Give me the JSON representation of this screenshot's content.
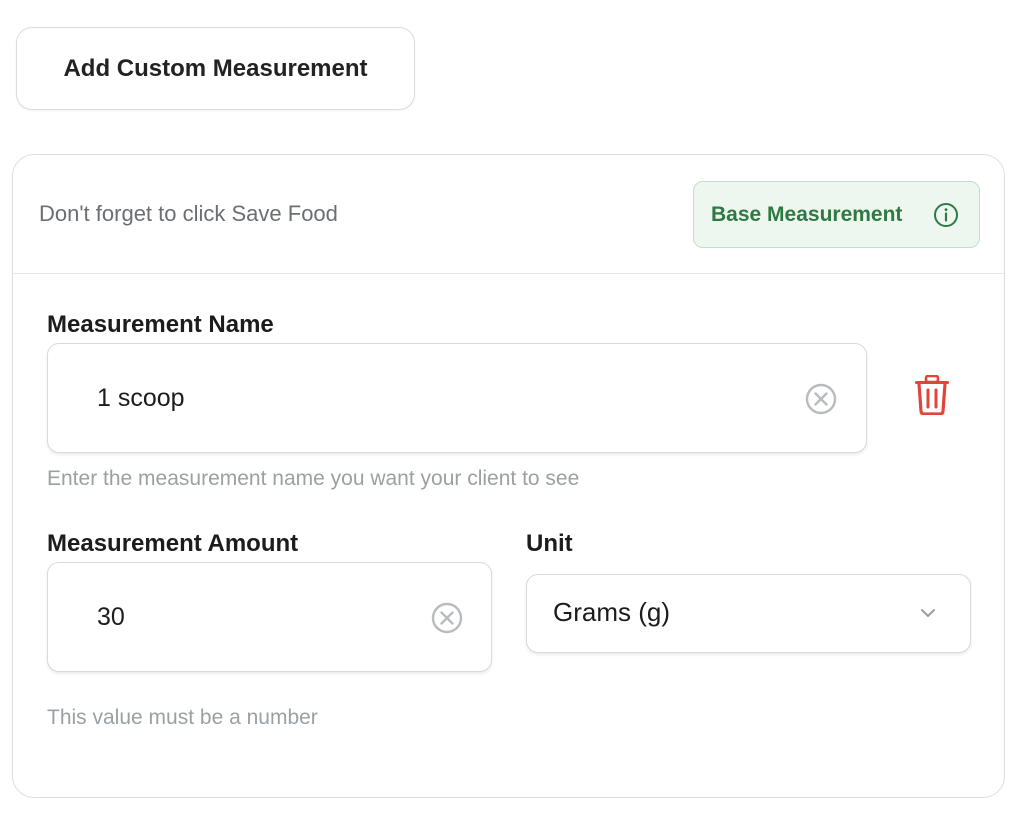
{
  "toolbar": {
    "add_custom_label": "Add Custom Measurement"
  },
  "card": {
    "reminder": "Don't forget to click Save Food",
    "badge_label": "Base Measurement",
    "badge_icon": "info-icon",
    "colors": {
      "badge_text": "#2e7a43",
      "badge_bg": "#eef7ef",
      "delete": "#e0453a"
    }
  },
  "name_field": {
    "label": "Measurement Name",
    "value": "1 scoop",
    "helper": "Enter the measurement name you want your client to see",
    "clear_icon": "clear-circle-icon"
  },
  "delete": {
    "icon": "trash-icon"
  },
  "amount_field": {
    "label": "Measurement Amount",
    "value": "30",
    "helper": "This value must be a number",
    "clear_icon": "clear-circle-icon"
  },
  "unit_field": {
    "label": "Unit",
    "selected": "Grams (g)",
    "icon": "chevron-down-icon"
  }
}
